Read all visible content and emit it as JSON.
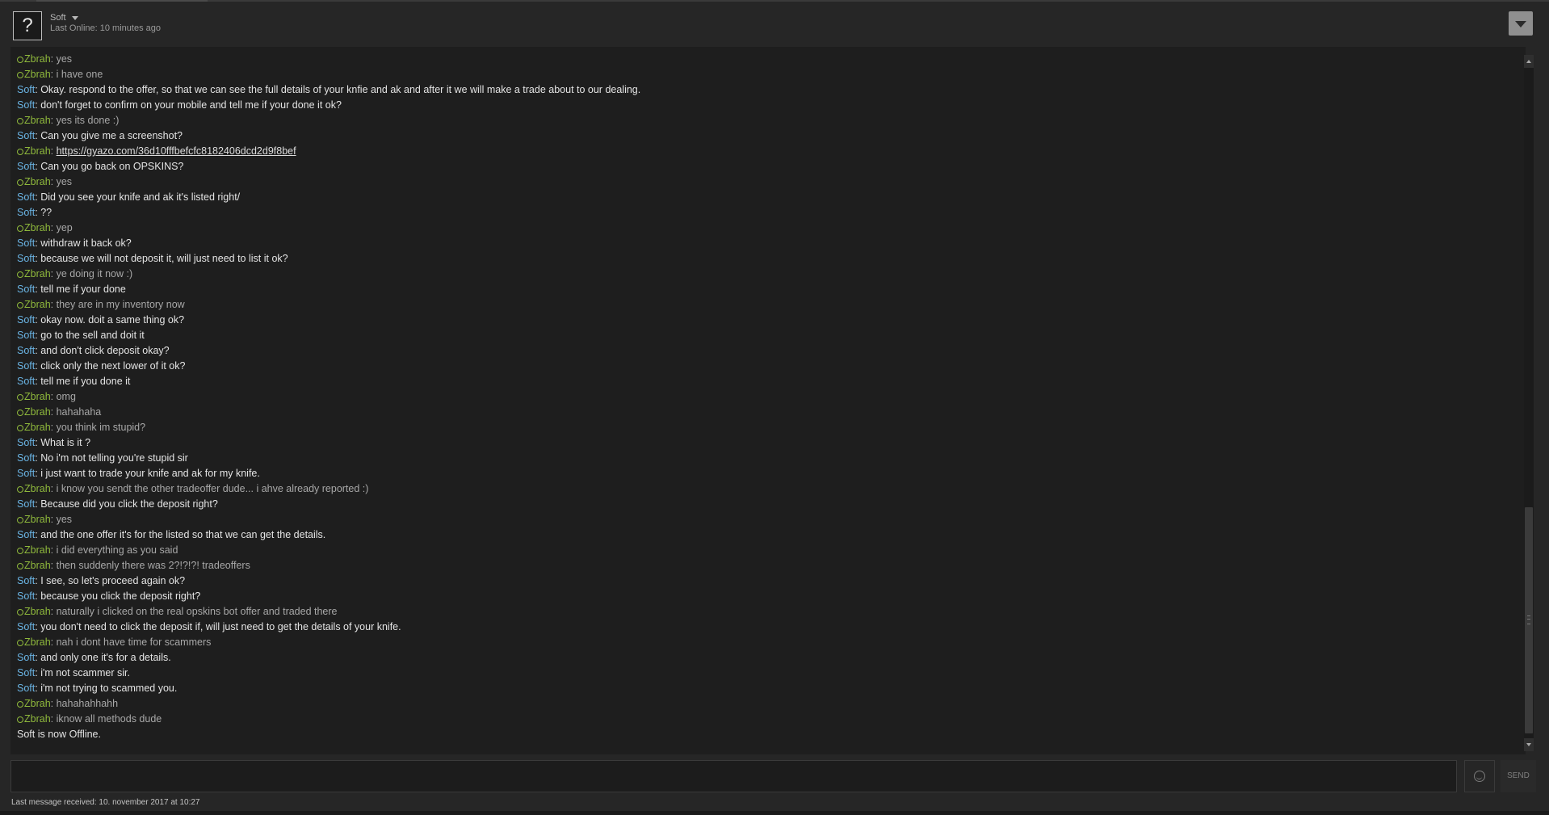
{
  "header": {
    "avatar_glyph": "?",
    "friend_name": "Soft",
    "last_online": "Last Online: 10 minutes ago"
  },
  "messages": [
    {
      "who": "zbrah",
      "sender": "Zbrah",
      "text": "yes"
    },
    {
      "who": "zbrah",
      "sender": "Zbrah",
      "text": "i have one"
    },
    {
      "who": "soft",
      "sender": "Soft",
      "text": "Okay. respond to the offer, so that we can see the full details of your knfie and ak and after it we will make a trade about to our dealing."
    },
    {
      "who": "soft",
      "sender": "Soft",
      "text": "don't forget to confirm on your mobile and tell me if your done it ok?"
    },
    {
      "who": "zbrah",
      "sender": "Zbrah",
      "text": "yes its done :)"
    },
    {
      "who": "soft",
      "sender": "Soft",
      "text": "Can you give me a screenshot?"
    },
    {
      "who": "zbrah",
      "sender": "Zbrah",
      "text": "https://gyazo.com/36d10fffbefcfc8182406dcd2d9f8bef",
      "is_link": true
    },
    {
      "who": "soft",
      "sender": "Soft",
      "text": "Can you go back on OPSKINS?"
    },
    {
      "who": "zbrah",
      "sender": "Zbrah",
      "text": "yes"
    },
    {
      "who": "soft",
      "sender": "Soft",
      "text": "Did you see your knife and ak it's listed right/"
    },
    {
      "who": "soft",
      "sender": "Soft",
      "text": "??"
    },
    {
      "who": "zbrah",
      "sender": "Zbrah",
      "text": "yep"
    },
    {
      "who": "soft",
      "sender": "Soft",
      "text": "withdraw it back ok?"
    },
    {
      "who": "soft",
      "sender": "Soft",
      "text": "because we will not deposit it, will just need to list it ok?"
    },
    {
      "who": "zbrah",
      "sender": "Zbrah",
      "text": "ye doing it now :)"
    },
    {
      "who": "soft",
      "sender": "Soft",
      "text": "tell me if your done"
    },
    {
      "who": "zbrah",
      "sender": "Zbrah",
      "text": "they are in my inventory now"
    },
    {
      "who": "soft",
      "sender": "Soft",
      "text": "okay now. doit a same thing ok?"
    },
    {
      "who": "soft",
      "sender": "Soft",
      "text": "go to the sell and doit it"
    },
    {
      "who": "soft",
      "sender": "Soft",
      "text": "and don't click deposit okay?"
    },
    {
      "who": "soft",
      "sender": "Soft",
      "text": "click only the next lower of it ok?"
    },
    {
      "who": "soft",
      "sender": "Soft",
      "text": "tell me if you done it"
    },
    {
      "who": "zbrah",
      "sender": "Zbrah",
      "text": "omg"
    },
    {
      "who": "zbrah",
      "sender": "Zbrah",
      "text": "hahahaha"
    },
    {
      "who": "zbrah",
      "sender": "Zbrah",
      "text": "you think im stupid?"
    },
    {
      "who": "soft",
      "sender": "Soft",
      "text": "What is it ?"
    },
    {
      "who": "soft",
      "sender": "Soft",
      "text": "No i'm not telling you're stupid sir"
    },
    {
      "who": "soft",
      "sender": "Soft",
      "text": "i just want to trade your knife and ak for my knife."
    },
    {
      "who": "zbrah",
      "sender": "Zbrah",
      "text": "i know you sendt the other tradeoffer dude... i ahve already reported :)"
    },
    {
      "who": "soft",
      "sender": "Soft",
      "text": "Because did you click the deposit right?"
    },
    {
      "who": "zbrah",
      "sender": "Zbrah",
      "text": "yes"
    },
    {
      "who": "soft",
      "sender": "Soft",
      "text": "and the one offer it's for the listed so that we can get the details."
    },
    {
      "who": "zbrah",
      "sender": "Zbrah",
      "text": "i did everything as you said"
    },
    {
      "who": "zbrah",
      "sender": "Zbrah",
      "text": "then suddenly there was 2?!?!?! tradeoffers"
    },
    {
      "who": "soft",
      "sender": "Soft",
      "text": "I see, so let's proceed again ok?"
    },
    {
      "who": "soft",
      "sender": "Soft",
      "text": "because you click the deposit right?"
    },
    {
      "who": "zbrah",
      "sender": "Zbrah",
      "text": "naturally i clicked on the real opskins bot offer and traded there"
    },
    {
      "who": "soft",
      "sender": "Soft",
      "text": "you don't need to click the deposit if, will just need to get the details of your knife."
    },
    {
      "who": "zbrah",
      "sender": "Zbrah",
      "text": "nah i dont have time for scammers"
    },
    {
      "who": "soft",
      "sender": "Soft",
      "text": "and only one it's for a details."
    },
    {
      "who": "soft",
      "sender": "Soft",
      "text": "i'm not scammer sir."
    },
    {
      "who": "soft",
      "sender": "Soft",
      "text": "i'm not trying to scammed you."
    },
    {
      "who": "zbrah",
      "sender": "Zbrah",
      "text": "hahahahhahh"
    },
    {
      "who": "zbrah",
      "sender": "Zbrah",
      "text": "iknow all methods dude"
    }
  ],
  "offline_notice": "Soft is now Offline.",
  "input": {
    "value": "",
    "placeholder": ""
  },
  "send_label": "SEND",
  "footer": {
    "last_message": "Last message received: 10. november 2017 at 10:27"
  },
  "colors": {
    "soft_name": "#6ab4e4",
    "zbrah_name": "#8fb93c",
    "background": "#262626"
  }
}
